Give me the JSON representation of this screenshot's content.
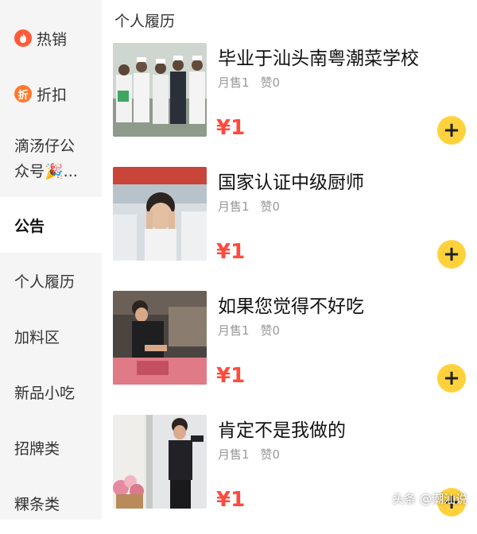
{
  "sidebar": {
    "items": [
      {
        "label": "热销",
        "icon": "flame-icon",
        "icon_glyph": "🔥"
      },
      {
        "label": "折扣",
        "icon": "discount-icon",
        "icon_glyph": "折"
      },
      {
        "label_line1": "滴汤仔公",
        "label_line2": "众号🎉..."
      },
      {
        "label": "公告"
      },
      {
        "label": "个人履历"
      },
      {
        "label": "加料区"
      },
      {
        "label": "新品小吃"
      },
      {
        "label": "招牌类"
      },
      {
        "label": "粿条类"
      }
    ],
    "active_index": 3
  },
  "section_title": "个人履历",
  "products": [
    {
      "name": "毕业于汕头南粤潮菜学校",
      "sold": "月售1",
      "likes": "赞0",
      "price": "¥1"
    },
    {
      "name": "国家认证中级厨师",
      "sold": "月售1",
      "likes": "赞0",
      "price": "¥1"
    },
    {
      "name": "如果您觉得不好吃",
      "sold": "月售1",
      "likes": "赞0",
      "price": "¥1"
    },
    {
      "name": "肯定不是我做的",
      "sold": "月售1",
      "likes": "赞0",
      "price": "¥1"
    }
  ],
  "add_button_glyph": "+",
  "watermark": "头条 @潮汕说",
  "colors": {
    "price": "#ff4a3d",
    "add_button": "#ffd23c",
    "sidebar_bg": "#f5f5f5"
  }
}
